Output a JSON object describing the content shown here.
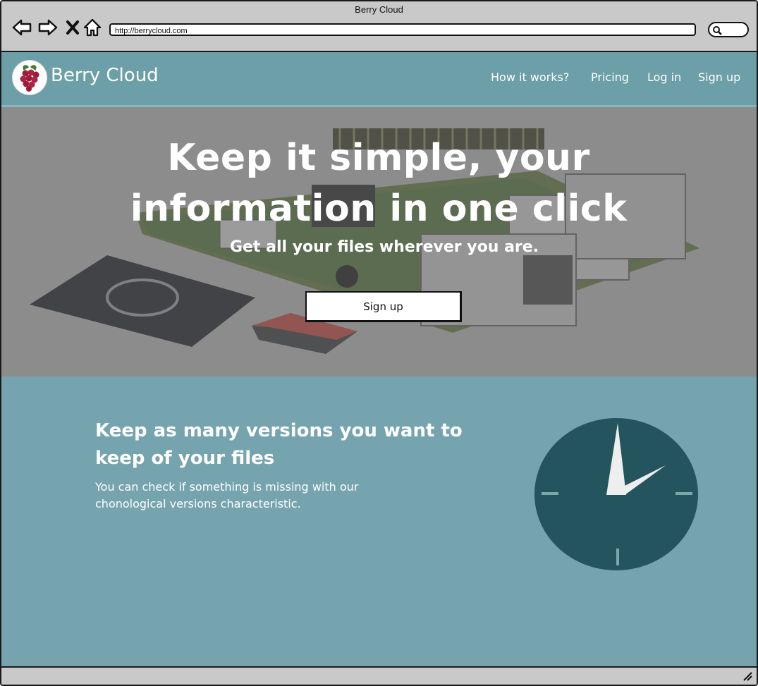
{
  "window": {
    "title": "Berry Cloud"
  },
  "browser": {
    "url": "http://berrycloud.com",
    "back_icon": "arrow-left-icon",
    "forward_icon": "arrow-right-icon",
    "stop_icon": "close-icon",
    "home_icon": "home-icon",
    "search_icon": "search-icon"
  },
  "header": {
    "brand": "Berry Cloud",
    "logo_icon": "raspberry-logo-icon",
    "nav": [
      "How it works?",
      "Pricing",
      "Log in",
      "Sign up"
    ]
  },
  "hero": {
    "title": "Keep it simple, your information in one click",
    "subtitle": "Get all your files wherever you are.",
    "cta": "Sign up"
  },
  "feature": {
    "title": "Keep as many versions you want to keep of your files",
    "text": "You can check if something is missing with our chonological versions characteristic.",
    "icon": "clock-icon"
  },
  "colors": {
    "header": "#6c9fa8",
    "section": "#75a4af",
    "clock_face": "#24555f"
  }
}
